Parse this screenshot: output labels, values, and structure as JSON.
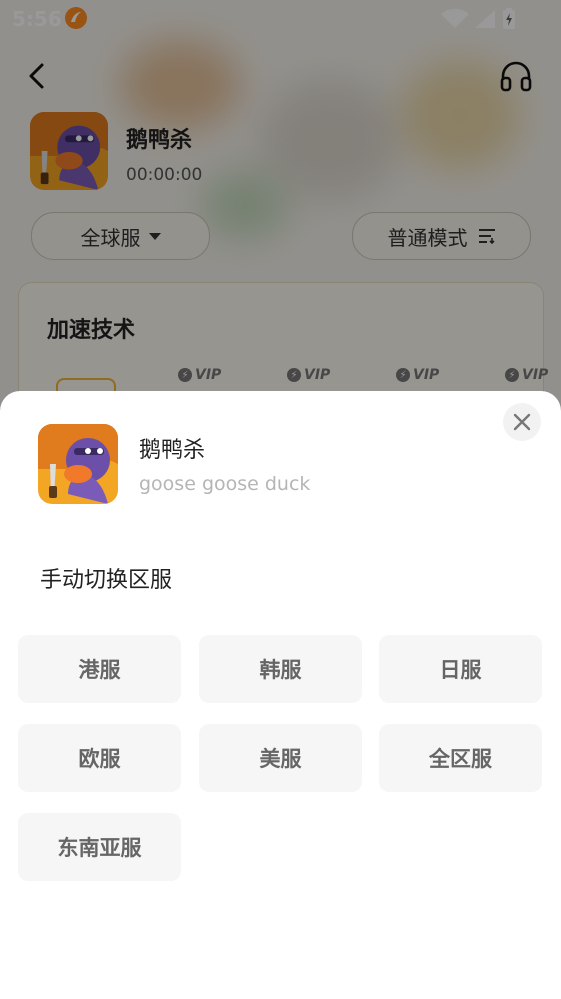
{
  "status_bar": {
    "time": "5:56"
  },
  "game": {
    "title": "鹅鸭杀",
    "timer": "00:00:00",
    "subtitle": "goose goose duck"
  },
  "controls": {
    "region_label": "全球服",
    "mode_label": "普通模式"
  },
  "accel": {
    "title": "加速技术",
    "vip_label": "VIP"
  },
  "sheet": {
    "section_title": "手动切换区服",
    "servers": [
      "港服",
      "韩服",
      "日服",
      "欧服",
      "美服",
      "全区服",
      "东南亚服"
    ]
  },
  "colors": {
    "accent": "#f0b53a",
    "overlay": "rgba(0,0,0,0.40)",
    "button_bg": "#f6f6f6",
    "button_text": "#666666"
  }
}
